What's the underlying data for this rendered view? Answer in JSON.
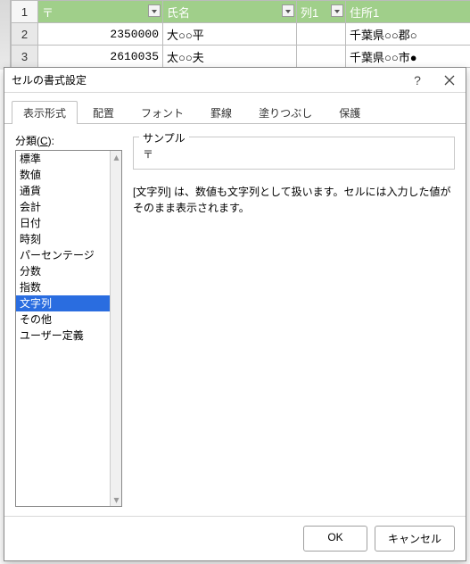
{
  "sheet": {
    "headers": [
      "〒",
      "氏名",
      "列1",
      "住所1"
    ],
    "rows": [
      {
        "n": "1"
      },
      {
        "n": "2",
        "zip": "2350000",
        "name": "大○○平",
        "c": "",
        "addr": "千葉県○○郡○"
      },
      {
        "n": "3",
        "zip": "2610035",
        "name": "太○○夫",
        "c": "",
        "addr": "千葉県○○市●"
      }
    ]
  },
  "dialog": {
    "title": "セルの書式設定",
    "tabs": [
      "表示形式",
      "配置",
      "フォント",
      "罫線",
      "塗りつぶし",
      "保護"
    ],
    "category_label_pre": "分類(",
    "category_label_u": "C",
    "category_label_post": "):",
    "categories": [
      "標準",
      "数値",
      "通貨",
      "会計",
      "日付",
      "時刻",
      "パーセンテージ",
      "分数",
      "指数",
      "文字列",
      "その他",
      "ユーザー定義"
    ],
    "selected_category": "文字列",
    "sample_label": "サンプル",
    "sample_value": "〒",
    "description": "[文字列] は、数値も文字列として扱います。セルには入力した値がそのまま表示されます。",
    "ok": "OK",
    "cancel": "キャンセル"
  }
}
